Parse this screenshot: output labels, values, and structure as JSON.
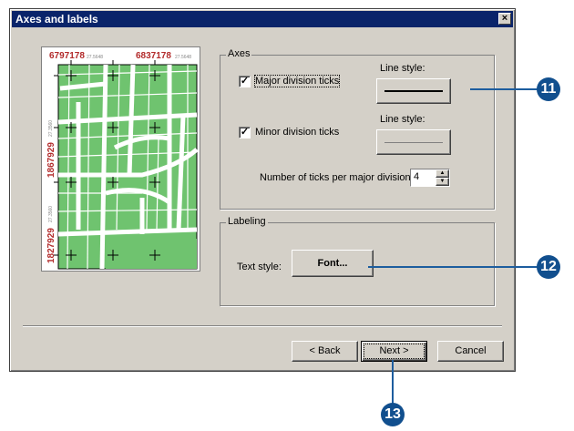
{
  "dialog": {
    "title": "Axes and labels",
    "close_symbol": "×"
  },
  "preview": {
    "top_labels": [
      "6797178",
      "6837178"
    ],
    "top_small": [
      "27.5648",
      "27.5648"
    ],
    "left_labels": [
      "1867929",
      "1827929"
    ],
    "left_small": [
      "27.3560",
      "27.3560"
    ]
  },
  "axes": {
    "group_label": "Axes",
    "major": {
      "label": "Major division ticks",
      "checked": true
    },
    "minor": {
      "label": "Minor division ticks",
      "checked": true
    },
    "major_line_label": "Line style:",
    "minor_line_label": "Line style:",
    "ticks_label": "Number of ticks per major division:",
    "ticks_value": "4"
  },
  "labeling": {
    "group_label": "Labeling",
    "text_style_label": "Text style:",
    "font_button": "Font..."
  },
  "buttons": {
    "back": "< Back",
    "next": "Next >",
    "cancel": "Cancel"
  },
  "callouts": [
    "11",
    "12",
    "13"
  ],
  "colors": {
    "titlebar": "#0a246a",
    "callout": "#114f8e",
    "map_green": "#6fc36f",
    "label_red": "#b22a2a"
  }
}
